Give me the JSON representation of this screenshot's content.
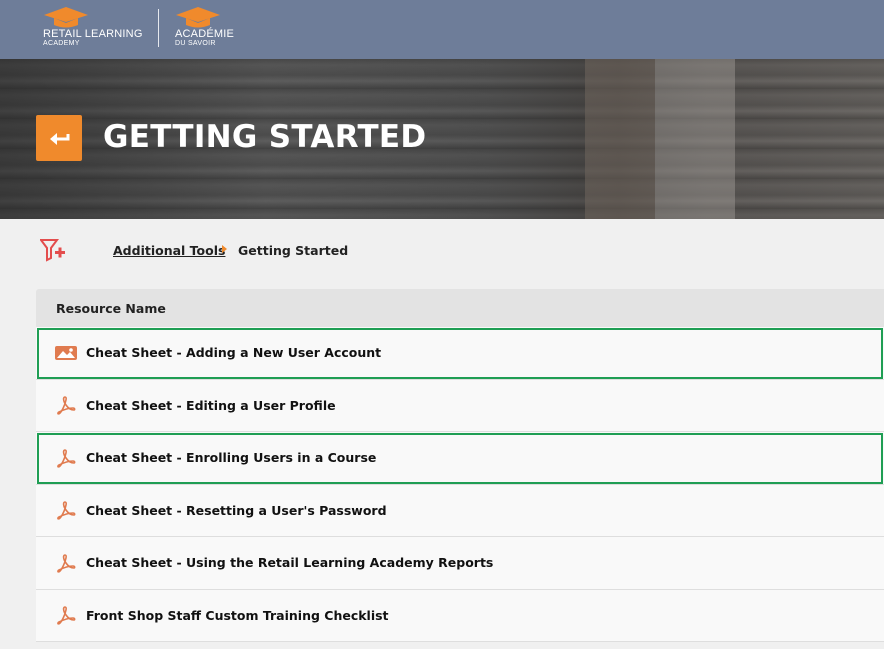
{
  "header": {
    "logo_en": {
      "line1": "RETAIL LEARNING",
      "line2": "ACADEMY"
    },
    "logo_fr": {
      "line1": "ACADÉMIE",
      "line2": "DU SAVOIR"
    },
    "bar_color": "#6e7d99",
    "accent_color": "#f08a2c"
  },
  "hero": {
    "back_icon": "back-arrow-icon",
    "title": "GETTING STARTED"
  },
  "breadcrumb": {
    "filter_icon": "filter-add-icon",
    "parent": "Additional Tools",
    "current": "Getting Started"
  },
  "table": {
    "column_header": "Resource Name",
    "rows": [
      {
        "icon": "image-icon",
        "name": "Cheat Sheet - Adding a New User Account",
        "highlighted": true
      },
      {
        "icon": "pdf-icon",
        "name": "Cheat Sheet - Editing a User Profile",
        "highlighted": false
      },
      {
        "icon": "pdf-icon",
        "name": "Cheat Sheet - Enrolling Users in a Course",
        "highlighted": true
      },
      {
        "icon": "pdf-icon",
        "name": "Cheat Sheet - Resetting a User's Password",
        "highlighted": false
      },
      {
        "icon": "pdf-icon",
        "name": "Cheat Sheet - Using the Retail Learning Academy Reports",
        "highlighted": false
      },
      {
        "icon": "pdf-icon",
        "name": "Front Shop Staff Custom Training Checklist",
        "highlighted": false
      }
    ],
    "highlight_color": "#1f9e54"
  }
}
